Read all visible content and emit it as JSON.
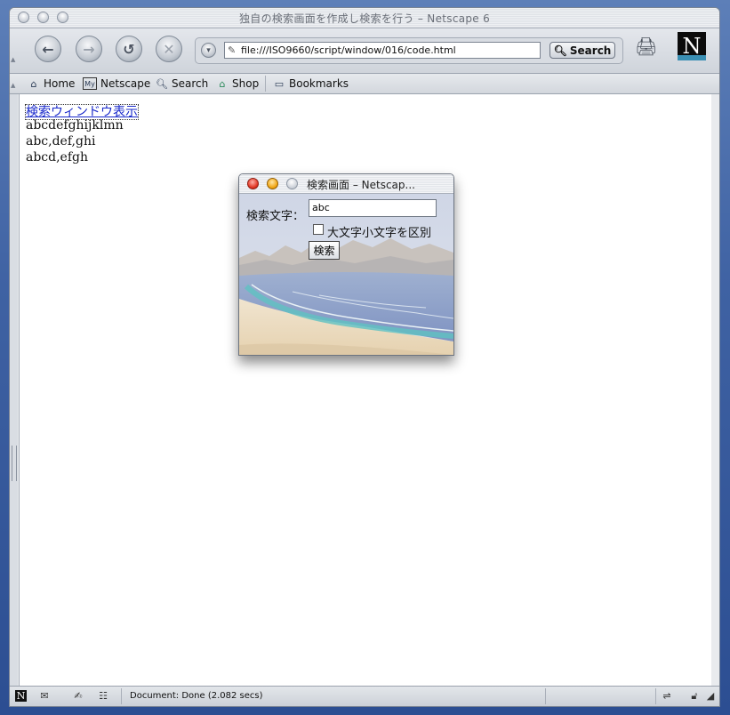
{
  "window": {
    "title": "独自の検索画面を作成し検索を行う – Netscape 6"
  },
  "toolbar": {
    "url": "file:///ISO9660/script/window/016/code.html",
    "search_label": "Search"
  },
  "personal_toolbar": {
    "items": [
      {
        "label": "Home"
      },
      {
        "label": "Netscape"
      },
      {
        "label": "Search"
      },
      {
        "label": "Shop"
      },
      {
        "label": "Bookmarks"
      }
    ]
  },
  "content": {
    "link": "検索ウィンドウ表示",
    "lines": [
      "abcdefghijklmn",
      "abc,def,ghi",
      "abcd,efgh"
    ]
  },
  "popup": {
    "title": "検索画面 – Netscap...",
    "label": "検索文字：",
    "input_value": "abc",
    "checkbox_label": "大文字小文字を区別",
    "button_label": "検索"
  },
  "status": {
    "text": "Document: Done (2.082 secs)"
  },
  "colors": {
    "desktop": "#3f62a3",
    "link": "#1a2acb"
  }
}
